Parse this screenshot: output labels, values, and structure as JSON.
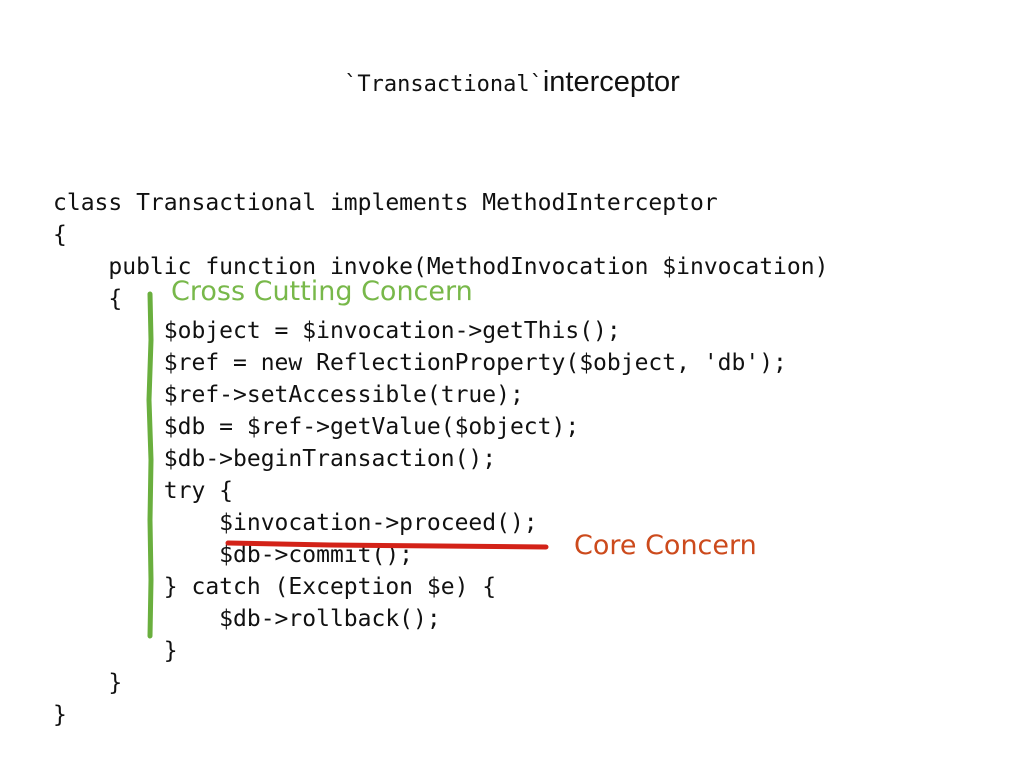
{
  "slide": {
    "title_mono": "`Transactional`",
    "title_text": "interceptor"
  },
  "code": {
    "lines": [
      "class Transactional implements MethodInterceptor",
      "{",
      "    public function invoke(MethodInvocation $invocation)",
      "    {",
      "        $object = $invocation->getThis();",
      "        $ref = new ReflectionProperty($object, 'db');",
      "        $ref->setAccessible(true);",
      "        $db = $ref->getValue($object);",
      "        $db->beginTransaction();",
      "        try {",
      "            $invocation->proceed();",
      "            $db->commit();",
      "        } catch (Exception $e) {",
      "            $db->rollback();",
      "        }",
      "    }",
      "}"
    ]
  },
  "annotations": {
    "cross_cutting": "Cross Cutting  Concern",
    "core": "Core Concern",
    "cross_cutting_color": "#78b84a",
    "core_color": "#cc4a1c"
  }
}
